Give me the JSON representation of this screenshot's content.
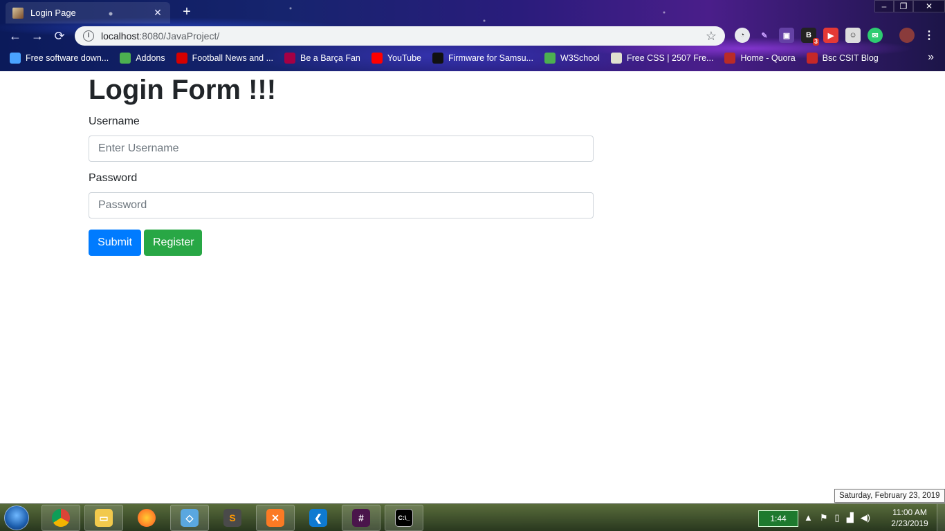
{
  "browser": {
    "tab_title": "Login Page",
    "tab_close": "✕",
    "new_tab": "+",
    "url_host": "localhost",
    "url_rest": ":8080/JavaProject/",
    "window_controls": {
      "minimize": "–",
      "restore": "❐",
      "close": "✕"
    },
    "bookmarks": [
      {
        "label": "Free software down...",
        "icon": "globe-icon",
        "color": "#4aa3ff"
      },
      {
        "label": "Addons",
        "icon": "puzzle-icon",
        "color": "#4caf50"
      },
      {
        "label": "Football News and ...",
        "icon": "espn-icon",
        "color": "#d50000"
      },
      {
        "label": "Be a Barça Fan",
        "icon": "barca-icon",
        "color": "#a50044"
      },
      {
        "label": "YouTube",
        "icon": "youtube-icon",
        "color": "#ff0000"
      },
      {
        "label": "Firmware for Samsu...",
        "icon": "sammobile-icon",
        "color": "#111111"
      },
      {
        "label": "W3School",
        "icon": "w3-icon",
        "color": "#4caf50"
      },
      {
        "label": "Free CSS | 2507 Fre...",
        "icon": "freecss-icon",
        "color": "#e0e0d0"
      },
      {
        "label": "Home - Quora",
        "icon": "quora-icon",
        "color": "#b92b27"
      },
      {
        "label": "Bsc CSIT Blog",
        "icon": "blog-icon",
        "color": "#c62828"
      }
    ],
    "bookmarks_more": "»",
    "extension_badge": "3"
  },
  "page": {
    "heading": "Login Form !!!",
    "username_label": "Username",
    "username_placeholder": "Enter Username",
    "password_label": "Password",
    "password_placeholder": "Password",
    "submit_label": "Submit",
    "register_label": "Register"
  },
  "tooltip": "Saturday, February 23, 2019",
  "taskbar": {
    "battery_time": "1:44",
    "clock_time": "11:00 AM",
    "clock_date": "2/23/2019"
  }
}
